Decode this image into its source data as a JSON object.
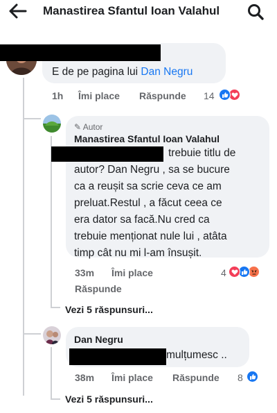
{
  "header": {
    "title": "Manastirea Sfantul Ioan Valahul",
    "back_icon": "arrow-left-icon",
    "search_icon": "search-icon"
  },
  "comment1": {
    "text_prefix": "E de pe pagina lui ",
    "text_link": "Dan Negru",
    "time": "1h",
    "like": "Îmi place",
    "reply": "Răspunde",
    "reactions_count": "14",
    "reactions": [
      "like",
      "love"
    ]
  },
  "reply1": {
    "badge": "Autor",
    "author": "Manastirea Sfantul Ioan Valahul",
    "lines": [
      "trebuie titlu de",
      "autor? Dan Negru , sa se bucure",
      "ca a reușit sa scrie ceva ce am",
      "preluat.Restul , a făcut ceea ce",
      "era dator sa facă.Nu cred ca",
      "trebuie menționat nule lui , atâta",
      "timp cât nu mi l-am  însușit."
    ],
    "time": "33m",
    "like": "Îmi place",
    "reply": "Răspunde",
    "reactions_count": "4",
    "reactions": [
      "love",
      "like",
      "angry"
    ],
    "more_replies": "Vezi 5 răspunsuri..."
  },
  "reply2": {
    "author": "Dan Negru",
    "text": "mulțumesc ..",
    "time": "38m",
    "like": "Îmi place",
    "reply": "Răspunde",
    "reactions_count": "8",
    "reactions": [
      "like"
    ],
    "more_replies": "Vezi 5 răspunsuri..."
  },
  "colors": {
    "like_blue": "#1877f2",
    "love_red": "#f33e58",
    "angry_orange": "#f7714b",
    "bubble_bg": "#f0f2f5",
    "meta_grey": "#65676b"
  }
}
